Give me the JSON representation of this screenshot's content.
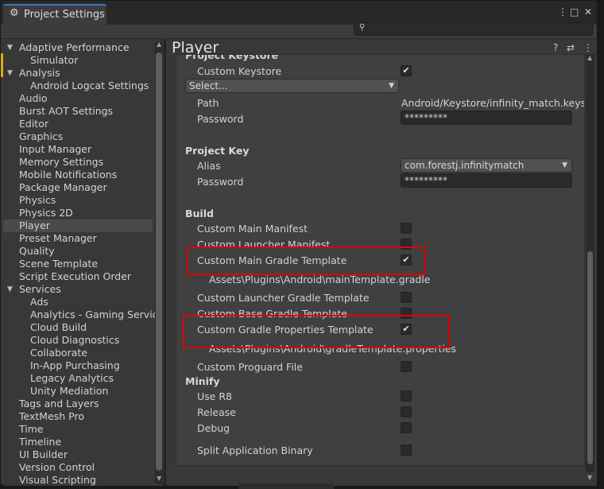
{
  "window": {
    "tab_title": "Project Settings",
    "buttons": [
      "⋮",
      "□",
      "✕"
    ]
  },
  "search": {
    "placeholder": ""
  },
  "sidebar": {
    "items": [
      {
        "label": "Adaptive Performance",
        "indent": 1,
        "expanded": true
      },
      {
        "label": "Simulator",
        "indent": 2
      },
      {
        "label": "Analysis",
        "indent": 1,
        "expanded": true
      },
      {
        "label": "Android Logcat Settings",
        "indent": 2
      },
      {
        "label": "Audio",
        "indent": 1
      },
      {
        "label": "Burst AOT Settings",
        "indent": 1
      },
      {
        "label": "Editor",
        "indent": 1
      },
      {
        "label": "Graphics",
        "indent": 1
      },
      {
        "label": "Input Manager",
        "indent": 1
      },
      {
        "label": "Memory Settings",
        "indent": 1
      },
      {
        "label": "Mobile Notifications",
        "indent": 1
      },
      {
        "label": "Package Manager",
        "indent": 1
      },
      {
        "label": "Physics",
        "indent": 1
      },
      {
        "label": "Physics 2D",
        "indent": 1
      },
      {
        "label": "Player",
        "indent": 1,
        "selected": true
      },
      {
        "label": "Preset Manager",
        "indent": 1
      },
      {
        "label": "Quality",
        "indent": 1
      },
      {
        "label": "Scene Template",
        "indent": 1
      },
      {
        "label": "Script Execution Order",
        "indent": 1
      },
      {
        "label": "Services",
        "indent": 1,
        "expanded": true
      },
      {
        "label": "Ads",
        "indent": 2
      },
      {
        "label": "Analytics - Gaming Service",
        "indent": 2
      },
      {
        "label": "Cloud Build",
        "indent": 2
      },
      {
        "label": "Cloud Diagnostics",
        "indent": 2
      },
      {
        "label": "Collaborate",
        "indent": 2
      },
      {
        "label": "In-App Purchasing",
        "indent": 2
      },
      {
        "label": "Legacy Analytics",
        "indent": 2
      },
      {
        "label": "Unity Mediation",
        "indent": 2
      },
      {
        "label": "Tags and Layers",
        "indent": 1
      },
      {
        "label": "TextMesh Pro",
        "indent": 1
      },
      {
        "label": "Time",
        "indent": 1
      },
      {
        "label": "Timeline",
        "indent": 1
      },
      {
        "label": "UI Builder",
        "indent": 1
      },
      {
        "label": "Version Control",
        "indent": 1
      },
      {
        "label": "Visual Scripting",
        "indent": 1
      }
    ]
  },
  "main": {
    "title": "Player",
    "header_icons": [
      "?",
      "⇄",
      "⋮"
    ],
    "keystore": {
      "section_partial": "Project Keystore",
      "custom_keystore_label": "Custom Keystore",
      "custom_keystore_checked": "✔",
      "select_label": "Select...",
      "path_label": "Path",
      "path_value": "Android/Keystore/infinity_match.keystore",
      "password_label": "Password",
      "password_value": "*********"
    },
    "project_key": {
      "section": "Project Key",
      "alias_label": "Alias",
      "alias_value": "com.forestj.infinitymatch",
      "password_label": "Password",
      "password_value": "*********"
    },
    "build": {
      "section": "Build",
      "custom_main_manifest": "Custom Main Manifest",
      "custom_launcher_manifest": "Custom Launcher Manifest",
      "custom_main_gradle": "Custom Main Gradle Template",
      "custom_main_gradle_check": "✔",
      "main_gradle_path": "Assets\\Plugins\\Android\\mainTemplate.gradle",
      "custom_launcher_gradle": "Custom Launcher Gradle Template",
      "custom_base_gradle": "Custom Base Gradle Template",
      "custom_gradle_props": "Custom Gradle Properties Template",
      "custom_gradle_props_check": "✔",
      "gradle_props_path": "Assets\\Plugins\\Android\\gradleTemplate.properties",
      "custom_proguard": "Custom Proguard File"
    },
    "minify": {
      "section": "Minify",
      "use_r8": "Use R8",
      "release": "Release",
      "debug": "Debug"
    },
    "split_binary": "Split Application Binary"
  },
  "colors": {
    "highlight": "#e00000",
    "selection": "#4a4a4a",
    "tab_accent": "#3a79bb"
  }
}
